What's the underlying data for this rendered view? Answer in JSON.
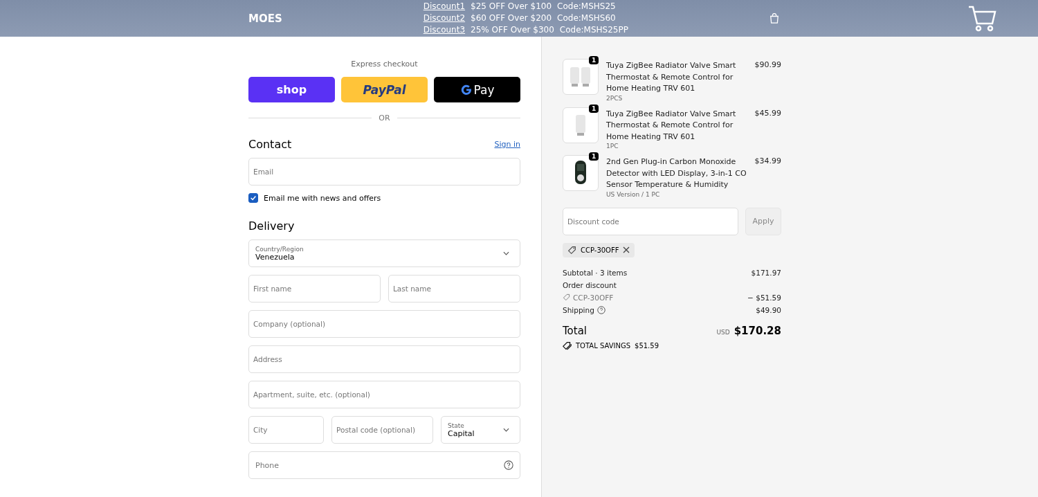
{
  "header": {
    "logo": "MOES",
    "promos": [
      {
        "link": "Discount1",
        "offer": "$25 OFF Over $100",
        "code": "Code:MSHS25"
      },
      {
        "link": "Discount2",
        "offer": "$60 OFF Over $200",
        "code": "Code:MSHS60"
      },
      {
        "link": "Discount3",
        "offer": "25% OFF Over $300",
        "code": "Code:MSHS25PP"
      }
    ]
  },
  "express": {
    "title": "Express checkout",
    "buttons": [
      {
        "kind": "shop",
        "label": "shop"
      },
      {
        "kind": "paypal",
        "label": "PayPal"
      },
      {
        "kind": "gpay",
        "label": "Pay"
      }
    ],
    "divider": "OR"
  },
  "contact": {
    "title": "Contact",
    "sign_in": "Sign in",
    "email": {
      "placeholder": "Email"
    },
    "newsletter": {
      "label": "Email me with news and offers",
      "checked": true
    }
  },
  "delivery": {
    "title": "Delivery",
    "rows": [
      [
        {
          "kind": "select",
          "label": "Country/Region",
          "value": "Venezuela"
        }
      ],
      [
        {
          "kind": "input",
          "placeholder": "First name"
        },
        {
          "kind": "input",
          "placeholder": "Last name"
        }
      ],
      [
        {
          "kind": "input",
          "placeholder": "Company (optional)"
        }
      ],
      [
        {
          "kind": "input",
          "placeholder": "Address"
        }
      ],
      [
        {
          "kind": "input",
          "placeholder": "Apartment, suite, etc. (optional)"
        }
      ],
      [
        {
          "kind": "input",
          "placeholder": "City"
        },
        {
          "kind": "input",
          "placeholder": "Postal code (optional)"
        },
        {
          "kind": "select",
          "label": "State",
          "value": "Capital"
        }
      ],
      [
        {
          "kind": "help",
          "placeholder": "Phone"
        }
      ]
    ]
  },
  "cart": {
    "items": [
      {
        "kind": "valve2",
        "qty": "1",
        "name": "Tuya ZigBee Radiator Valve Smart Thermostat & Remote Control for Home Heating TRV 601",
        "variant": "2PCS",
        "price": "$90.99"
      },
      {
        "kind": "valve1",
        "qty": "1",
        "name": "Tuya ZigBee Radiator Valve Smart Thermostat & Remote Control for Home Heating TRV 601",
        "variant": "1PC",
        "price": "$45.99"
      },
      {
        "kind": "detector",
        "qty": "1",
        "name": "2nd Gen Plug-in Carbon Monoxide Detector with LED Display, 3-in-1 CO Sensor Temperature & Humidity",
        "variant": "US Version / 1 PC",
        "price": "$34.99"
      }
    ],
    "discount": {
      "placeholder": "Discount code",
      "apply": "Apply",
      "applied": "CCP-30OFF"
    },
    "subtotal": {
      "label": "Subtotal · 3 items",
      "value": "$171.97"
    },
    "order_discount": {
      "label": "Order discount",
      "code": "CCP-30OFF",
      "value": "− $51.59"
    },
    "shipping": {
      "label": "Shipping",
      "value": "$49.90"
    },
    "total": {
      "label": "Total",
      "currency": "USD",
      "value": "$170.28"
    },
    "savings": {
      "label": "TOTAL SAVINGS",
      "value": "$51.59"
    }
  }
}
